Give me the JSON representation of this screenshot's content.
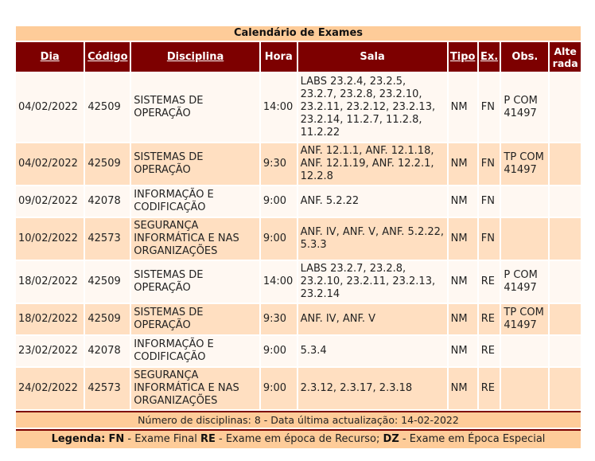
{
  "title": "Calendário de Exames",
  "columns": {
    "dia": "Dia",
    "codigo": "Código",
    "disciplina": "Disciplina",
    "hora": "Hora",
    "sala": "Sala",
    "tipo": "Tipo",
    "ex": "Ex.",
    "obs": "Obs.",
    "alterada_1": "Alte",
    "alterada_2": "rada"
  },
  "rows": [
    {
      "dia": "04/02/2022",
      "codigo": "42509",
      "disciplina": "SISTEMAS DE OPERAÇÃO",
      "hora": "14:00",
      "sala": "LABS 23.2.4, 23.2.5, 23.2.7, 23.2.8, 23.2.10, 23.2.11, 23.2.12, 23.2.13, 23.2.14, 11.2.7, 11.2.8, 11.2.22",
      "tipo": "NM",
      "ex": "FN",
      "obs": "P COM 41497",
      "alterada": ""
    },
    {
      "dia": "04/02/2022",
      "codigo": "42509",
      "disciplina": "SISTEMAS DE OPERAÇÃO",
      "hora": "9:30",
      "sala": "ANF. 12.1.1, ANF. 12.1.18, ANF. 12.1.19, ANF. 12.2.1, 12.2.8",
      "tipo": "NM",
      "ex": "FN",
      "obs": "TP COM 41497",
      "alterada": ""
    },
    {
      "dia": "09/02/2022",
      "codigo": "42078",
      "disciplina": "INFORMAÇÃO E CODIFICAÇÃO",
      "hora": "9:00",
      "sala": "ANF. 5.2.22",
      "tipo": "NM",
      "ex": "FN",
      "obs": "",
      "alterada": ""
    },
    {
      "dia": "10/02/2022",
      "codigo": "42573",
      "disciplina": "SEGURANÇA INFORMÁTICA E NAS ORGANIZAÇÕES",
      "hora": "9:00",
      "sala": "ANF. IV, ANF. V, ANF. 5.2.22, 5.3.3",
      "tipo": "NM",
      "ex": "FN",
      "obs": "",
      "alterada": ""
    },
    {
      "dia": "18/02/2022",
      "codigo": "42509",
      "disciplina": "SISTEMAS DE OPERAÇÃO",
      "hora": "14:00",
      "sala": "LABS 23.2.7, 23.2.8, 23.2.10, 23.2.11, 23.2.13, 23.2.14",
      "tipo": "NM",
      "ex": "RE",
      "obs": "P COM 41497",
      "alterada": ""
    },
    {
      "dia": "18/02/2022",
      "codigo": "42509",
      "disciplina": "SISTEMAS DE OPERAÇÃO",
      "hora": "9:30",
      "sala": "ANF. IV, ANF. V",
      "tipo": "NM",
      "ex": "RE",
      "obs": "TP COM 41497",
      "alterada": ""
    },
    {
      "dia": "23/02/2022",
      "codigo": "42078",
      "disciplina": "INFORMAÇÃO E CODIFICAÇÃO",
      "hora": "9:00",
      "sala": "5.3.4",
      "tipo": "NM",
      "ex": "RE",
      "obs": "",
      "alterada": ""
    },
    {
      "dia": "24/02/2022",
      "codigo": "42573",
      "disciplina": "SEGURANÇA INFORMÁTICA E NAS ORGANIZAÇÕES",
      "hora": "9:00",
      "sala": "2.3.12, 2.3.17, 2.3.18",
      "tipo": "NM",
      "ex": "RE",
      "obs": "",
      "alterada": ""
    }
  ],
  "footer": {
    "summary": "Número de disciplinas: 8 - Data última actualização: 14-02-2022"
  },
  "legend": {
    "label": "Legenda:",
    "fn_code": "FN",
    "fn_text": " - Exame Final ",
    "re_code": "RE",
    "re_text": " - Exame em época de Recurso; ",
    "dz_code": "DZ",
    "dz_text": " - Exame em Época Especial"
  },
  "colors": {
    "header_bg": "#7d0000",
    "title_bg": "#fecc99",
    "row_odd": "#fff8f2",
    "row_even": "#ffdfc1"
  }
}
